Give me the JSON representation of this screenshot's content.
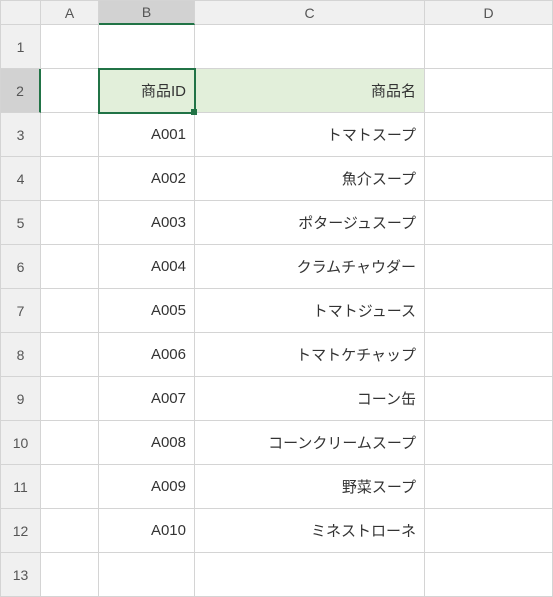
{
  "columns": [
    "A",
    "B",
    "C",
    "D"
  ],
  "rows": [
    "1",
    "2",
    "3",
    "4",
    "5",
    "6",
    "7",
    "8",
    "9",
    "10",
    "11",
    "12",
    "13"
  ],
  "active_cell": "B2",
  "selected_col": "B",
  "selected_row": "2",
  "headers": {
    "id": "商品ID",
    "name": "商品名"
  },
  "chart_data": {
    "type": "table",
    "title": "",
    "columns": [
      "商品ID",
      "商品名"
    ],
    "rows": [
      [
        "A001",
        "トマトスープ"
      ],
      [
        "A002",
        "魚介スープ"
      ],
      [
        "A003",
        "ポタージュスープ"
      ],
      [
        "A004",
        "クラムチャウダー"
      ],
      [
        "A005",
        "トマトジュース"
      ],
      [
        "A006",
        "トマトケチャップ"
      ],
      [
        "A007",
        "コーン缶"
      ],
      [
        "A008",
        "コーンクリームスープ"
      ],
      [
        "A009",
        "野菜スープ"
      ],
      [
        "A010",
        "ミネストローネ"
      ]
    ]
  }
}
